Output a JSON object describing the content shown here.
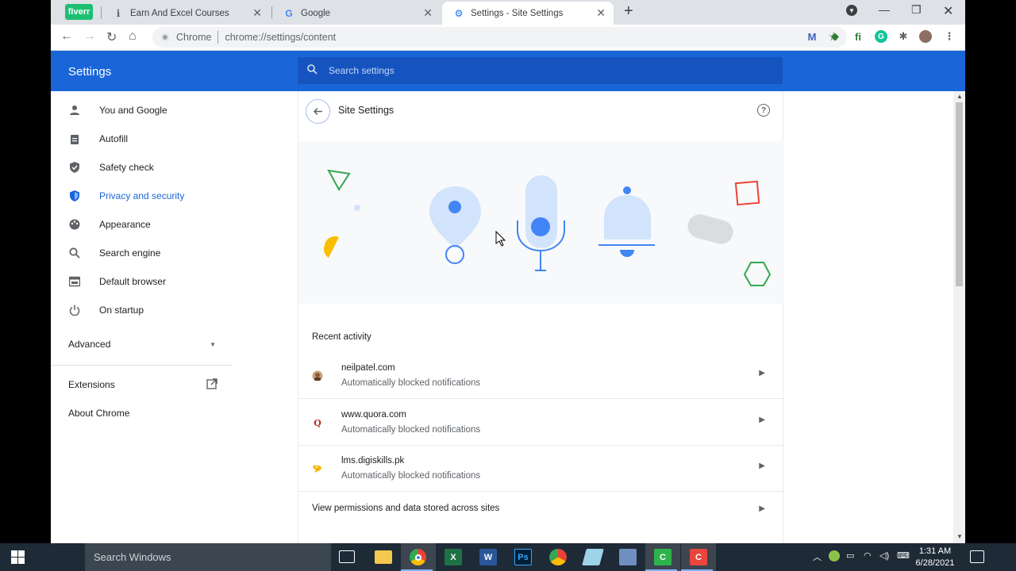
{
  "tabs": [
    {
      "label": "",
      "badge": "fiverr"
    },
    {
      "label": "Earn And Excel Courses",
      "icon": "info-icon"
    },
    {
      "label": "Google",
      "icon": "google-icon"
    },
    {
      "label": "Settings - Site Settings",
      "icon": "gear-icon",
      "active": true
    }
  ],
  "toolbar": {
    "site_label": "Chrome",
    "url": "chrome://settings/content"
  },
  "header": {
    "title": "Settings",
    "search_placeholder": "Search settings"
  },
  "sidebar": {
    "items": [
      {
        "label": "You and Google",
        "icon": "person-icon"
      },
      {
        "label": "Autofill",
        "icon": "clipboard-icon"
      },
      {
        "label": "Safety check",
        "icon": "shield-check-icon"
      },
      {
        "label": "Privacy and security",
        "icon": "shield-icon",
        "active": true
      },
      {
        "label": "Appearance",
        "icon": "palette-icon"
      },
      {
        "label": "Search engine",
        "icon": "search-icon"
      },
      {
        "label": "Default browser",
        "icon": "browser-icon"
      },
      {
        "label": "On startup",
        "icon": "power-icon"
      }
    ],
    "advanced": "Advanced",
    "extensions": "Extensions",
    "about": "About Chrome"
  },
  "content": {
    "title": "Site Settings",
    "recent_label": "Recent activity",
    "rows": [
      {
        "site": "neilpatel.com",
        "desc": "Automatically blocked notifications"
      },
      {
        "site": "www.quora.com",
        "desc": "Automatically blocked notifications"
      },
      {
        "site": "lms.digiskills.pk",
        "desc": "Automatically blocked notifications"
      }
    ],
    "permissions_link": "View permissions and data stored across sites"
  },
  "taskbar": {
    "search_placeholder": "Search Windows",
    "time": "1:31 AM",
    "date": "6/28/2021"
  },
  "colors": {
    "accent": "#1a66d9",
    "header_bg": "#1a66d9"
  }
}
